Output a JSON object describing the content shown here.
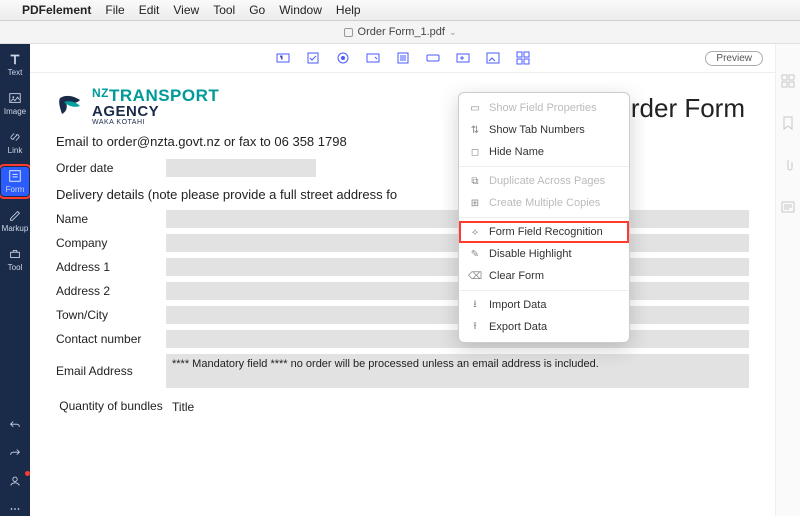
{
  "menubar": {
    "app": "PDFelement",
    "items": [
      "File",
      "Edit",
      "View",
      "Tool",
      "Go",
      "Window",
      "Help"
    ]
  },
  "tab": {
    "filename": "Order Form_1.pdf"
  },
  "left_toolbar": {
    "items": [
      {
        "id": "text",
        "label": "Text"
      },
      {
        "id": "image",
        "label": "Image"
      },
      {
        "id": "link",
        "label": "Link"
      },
      {
        "id": "form",
        "label": "Form"
      },
      {
        "id": "markup",
        "label": "Markup"
      },
      {
        "id": "tool",
        "label": "Tool"
      }
    ]
  },
  "toolbar": {
    "preview": "Preview"
  },
  "context_menu": {
    "items": [
      {
        "label": "Show Field Properties",
        "disabled": true
      },
      {
        "label": "Show Tab Numbers"
      },
      {
        "label": "Hide Name"
      },
      {
        "label": "Duplicate Across Pages",
        "disabled": true
      },
      {
        "label": "Create Multiple Copies",
        "disabled": true
      },
      {
        "label": "Form Field Recognition",
        "highlight": true
      },
      {
        "label": "Disable Highlight"
      },
      {
        "label": "Clear Form"
      },
      {
        "label": "Import Data"
      },
      {
        "label": "Export Data"
      }
    ]
  },
  "doc": {
    "logo": {
      "nz": "NZ",
      "l1": "TRANSPORT",
      "l2": "AGENCY",
      "l3": "WAKA KOTAHI"
    },
    "title": "Order Form",
    "email_line": "Email to order@nzta.govt.nz or fax to 06 358 1798",
    "order_date": "Order date",
    "delivery_heading": "Delivery details (note please provide a full street address fo",
    "labels": {
      "name": "Name",
      "company": "Company",
      "addr1": "Address 1",
      "addr2": "Address 2",
      "town": "Town/City",
      "contact": "Contact number",
      "email": "Email Address"
    },
    "mandatory_note": "**** Mandatory field **** no order will be processed unless an email address is included.",
    "col_qty": "Quantity of bundles",
    "col_title": "Title"
  }
}
